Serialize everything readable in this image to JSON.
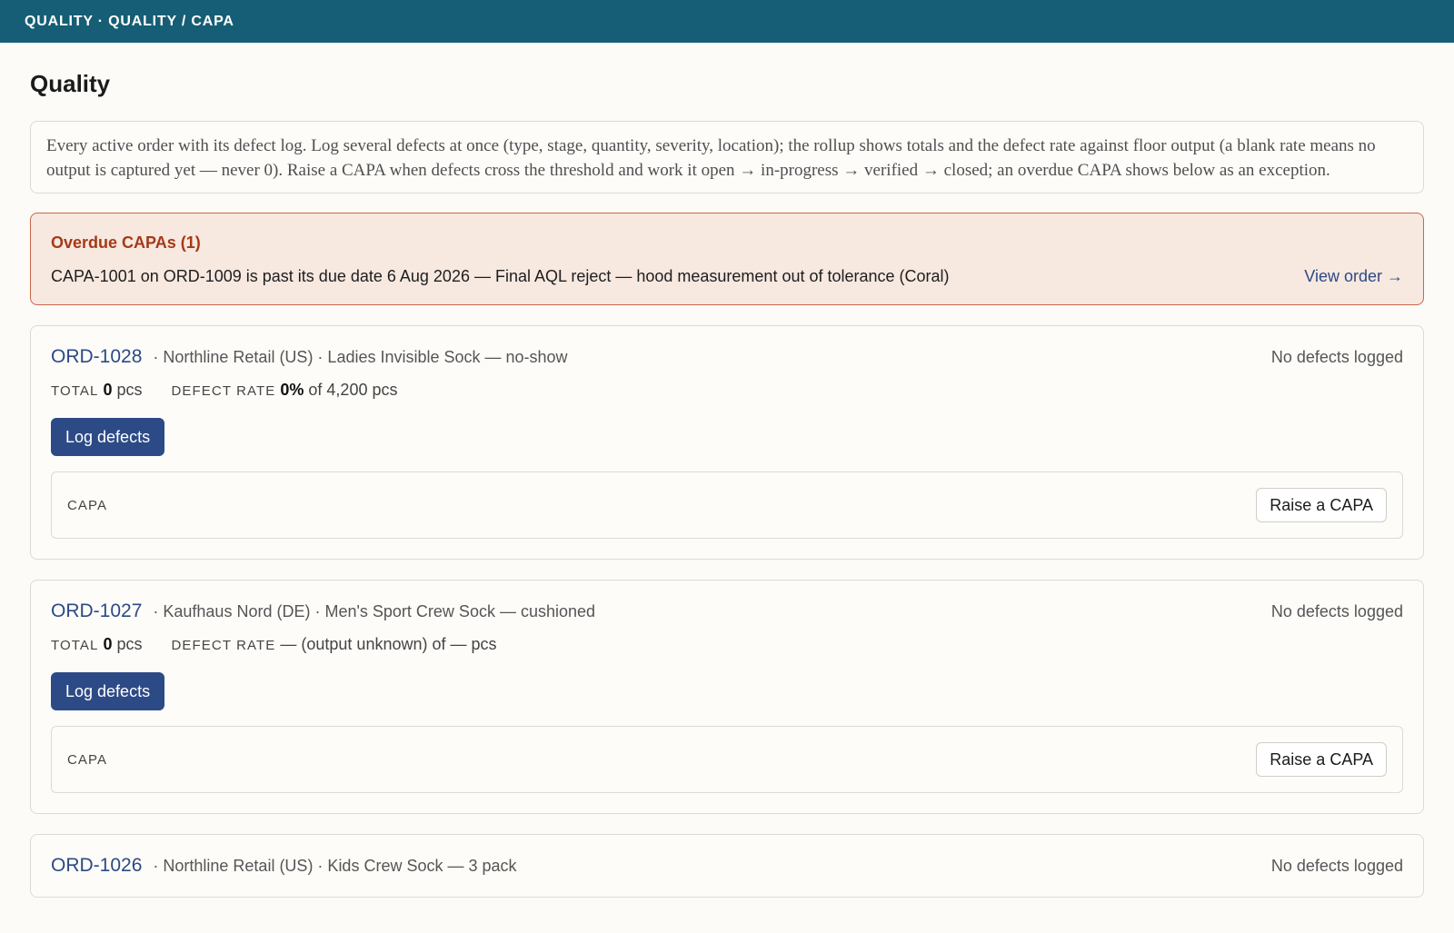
{
  "topbar": {
    "breadcrumb": "QUALITY · QUALITY / CAPA"
  },
  "page": {
    "title": "Quality",
    "intro": "Every active order with its defect log. Log several defects at once (type, stage, quantity, severity, location); the rollup shows totals and the defect rate against floor output (a blank rate means no output is captured yet — never 0). Raise a CAPA when defects cross the threshold and work it open → in-progress → verified → closed; an overdue CAPA shows below as an exception."
  },
  "alert": {
    "title": "Overdue CAPAs (1)",
    "message": "CAPA-1001 on ORD-1009 is past its due date 6 Aug 2026 — Final AQL reject — hood measurement out of tolerance (Coral)",
    "link": "View order →"
  },
  "labels": {
    "total": "TOTAL",
    "defect_rate": "DEFECT RATE",
    "capa": "CAPA",
    "log_defects": "Log defects",
    "raise_capa": "Raise a CAPA"
  },
  "orders": [
    {
      "id": "ORD-1028",
      "meta": "· Northline Retail (US) · Ladies Invisible Sock — no-show",
      "status": "No defects logged",
      "total_value": "0",
      "total_unit": " pcs",
      "rate_value": "0%",
      "rate_rest": " of 4,200 pcs"
    },
    {
      "id": "ORD-1027",
      "meta": "· Kaufhaus Nord (DE) · Men's Sport Crew Sock — cushioned",
      "status": "No defects logged",
      "total_value": "0",
      "total_unit": " pcs",
      "rate_value": "",
      "rate_rest": "— (output unknown) of — pcs"
    },
    {
      "id": "ORD-1026",
      "meta": "· Northline Retail (US) · Kids Crew Sock — 3 pack",
      "status": "No defects logged"
    }
  ]
}
